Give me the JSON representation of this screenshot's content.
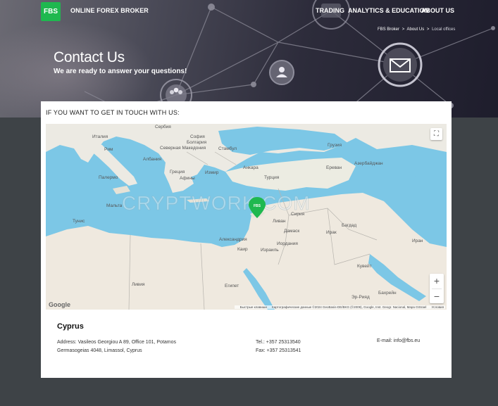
{
  "header": {
    "logo_text": "FBS",
    "tagline": "ONLINE FOREX BROKER",
    "nav": {
      "trading": "TRADING",
      "analytics": "ANALYTICS & EDUCATION",
      "about": "ABOUT US"
    }
  },
  "breadcrumb": {
    "items": [
      "FBS Broker",
      "About Us",
      "Local offices"
    ],
    "separator": ">"
  },
  "hero": {
    "title": "Contact Us",
    "subtitle": "We are ready to answer your questions!"
  },
  "card": {
    "heading": "IF YOU WANT TO GET IN TOUCH WITH US:"
  },
  "map": {
    "labels": {
      "italy": "Италия",
      "serbia": "Сербия",
      "bulgaria": "Болгария",
      "rome": "Рим",
      "albania": "Албания",
      "north_macedonia": "Северная Македония",
      "sofia": "София",
      "istanbul": "Стамбул",
      "georgia": "Грузия",
      "greece": "Греция",
      "turkey": "Турция",
      "ankara": "Анкара",
      "yerevan": "Ереван",
      "azerbaijan": "Азербайджан",
      "palermo": "Палермо",
      "athens": "Афины",
      "izmir": "Измир",
      "malta": "Мальта",
      "tunisia": "Тунис",
      "syria": "Сирия",
      "lebanon": "Ливан",
      "damascus": "Дамаск",
      "iraq": "Ирак",
      "iran": "Иран",
      "baghdad": "Багдад",
      "alexandria": "Александрия",
      "cairo": "Каир",
      "israel": "Израиль",
      "jordan": "Иордания",
      "libya": "Ливия",
      "egypt": "Египет",
      "kuwait": "Кувейт",
      "bahrain": "Бахрейн",
      "riyadh": "Эр-Рияд"
    },
    "pin_label": "FBS",
    "google": "Google",
    "attribution": [
      "Быстрые клавиши",
      "Картографические данные ©2024 GeoBasis-DE/BKG (©2009), Google, Inst. Geogr. Nacional, Mapa GISrael",
      "Условия"
    ],
    "watermark": "CRYPTWORK.COM",
    "fullscreen_icon": "⛶",
    "zoom_in": "+",
    "zoom_out": "−"
  },
  "office": {
    "country": "Cyprus",
    "address_line1": "Address: Vasileos Georgiou A 89, Office 101, Potamos",
    "address_line2": "Germasogeias 4048, Limassol, Cyprus",
    "tel": "Tel.: +357 25313540",
    "fax": "Fax: +357 25313541",
    "email": "E-mail: info@fbs.eu"
  }
}
